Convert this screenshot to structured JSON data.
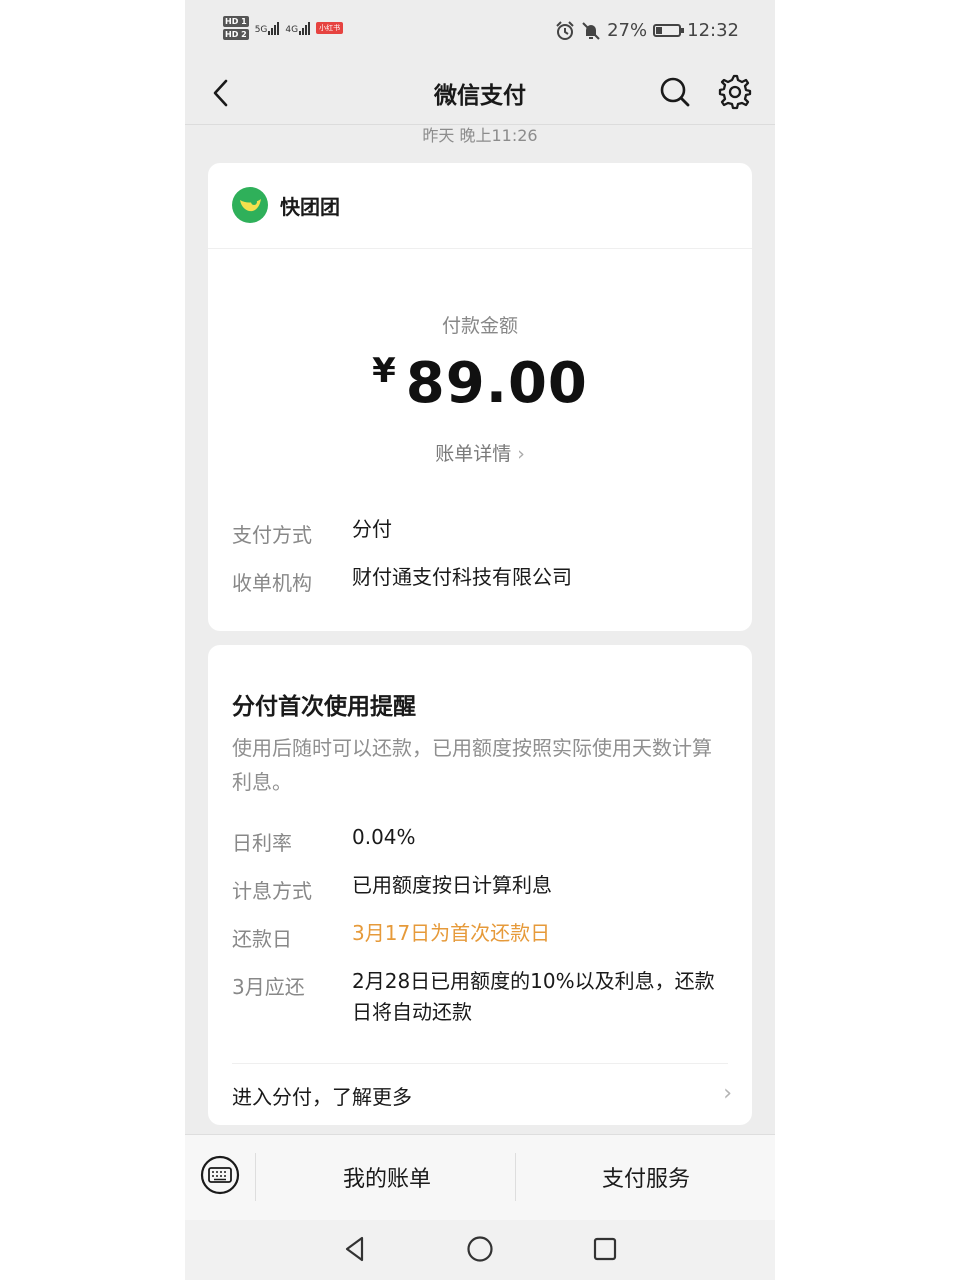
{
  "status_bar": {
    "hd1": "HD 1",
    "hd2": "HD 2",
    "net1": "5G",
    "net2": "4G",
    "app_badge": "小红书",
    "battery": "27%",
    "time": "12:32"
  },
  "nav": {
    "title": "微信支付",
    "back_icon": "chevron-left-icon",
    "search_icon": "search-icon",
    "settings_icon": "gear-icon"
  },
  "timestamp": "昨天 晚上11:26",
  "payment_card": {
    "merchant": "快团团",
    "amount_label": "付款金额",
    "currency": "¥",
    "amount": "89.00",
    "bill_detail": "账单详情",
    "rows": [
      {
        "key": "支付方式",
        "value": "分付"
      },
      {
        "key": "收单机构",
        "value": "财付通支付科技有限公司"
      }
    ]
  },
  "reminder_card": {
    "title": "分付首次使用提醒",
    "desc": "使用后随时可以还款，已用额度按照实际使用天数计算利息。",
    "rows": [
      {
        "key": "日利率",
        "value": "0.04%"
      },
      {
        "key": "计息方式",
        "value": "已用额度按日计算利息"
      },
      {
        "key": "还款日",
        "value": "3月17日为首次还款日"
      },
      {
        "key": "3月应还",
        "value": "2月28日已用额度的10%以及利息，还款日将自动还款"
      }
    ],
    "more_link": "进入分付，了解更多"
  },
  "tabbar": {
    "keyboard_icon": "keyboard-icon",
    "tab1": "我的账单",
    "tab2": "支付服务"
  },
  "colors": {
    "background": "#ededed",
    "card": "#ffffff",
    "highlight": "#e69a3a",
    "wechat_green": "#07c160"
  }
}
